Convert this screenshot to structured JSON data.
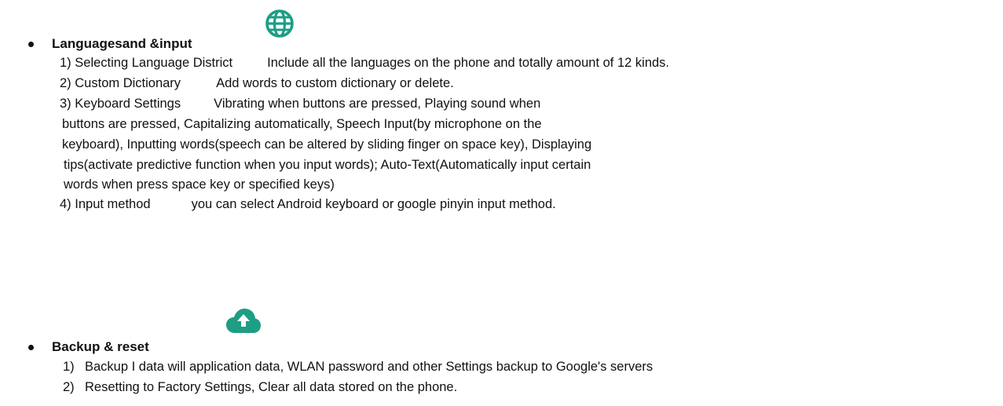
{
  "icon_color": "#1e9e84",
  "sections": [
    {
      "heading": "Languagesand &input",
      "icon": "globe-icon",
      "items": [
        {
          "number": "1)",
          "label": "Selecting Language District",
          "description": "Include all the languages on the phone and totally amount of 12 kinds."
        },
        {
          "number": "2)",
          "label": "Custom Dictionary",
          "description": "Add words to custom dictionary or delete."
        },
        {
          "number": "3)",
          "label": "Keyboard Settings",
          "description": "Vibrating when buttons are pressed, Playing sound when",
          "continuation": [
            "buttons are pressed, Capitalizing automatically, Speech Input(by microphone on the",
            "keyboard), Inputting words(speech can be altered by sliding finger on space key), Displaying",
            "tips(activate predictive function when you input words); Auto-Text(Automatically input certain",
            "words when press space key or specified keys)"
          ]
        },
        {
          "number": "4)",
          "label": "Input method",
          "description": "you can select Android keyboard or google pinyin input method."
        }
      ]
    },
    {
      "heading": "Backup & reset",
      "icon": "cloud-upload-icon",
      "items": [
        {
          "number": "1)",
          "text": "Backup I data will application data, WLAN password and other Settings backup to Google's servers"
        },
        {
          "number": "2)",
          "text": "Resetting to Factory Settings, Clear all data stored on the phone."
        }
      ]
    }
  ]
}
